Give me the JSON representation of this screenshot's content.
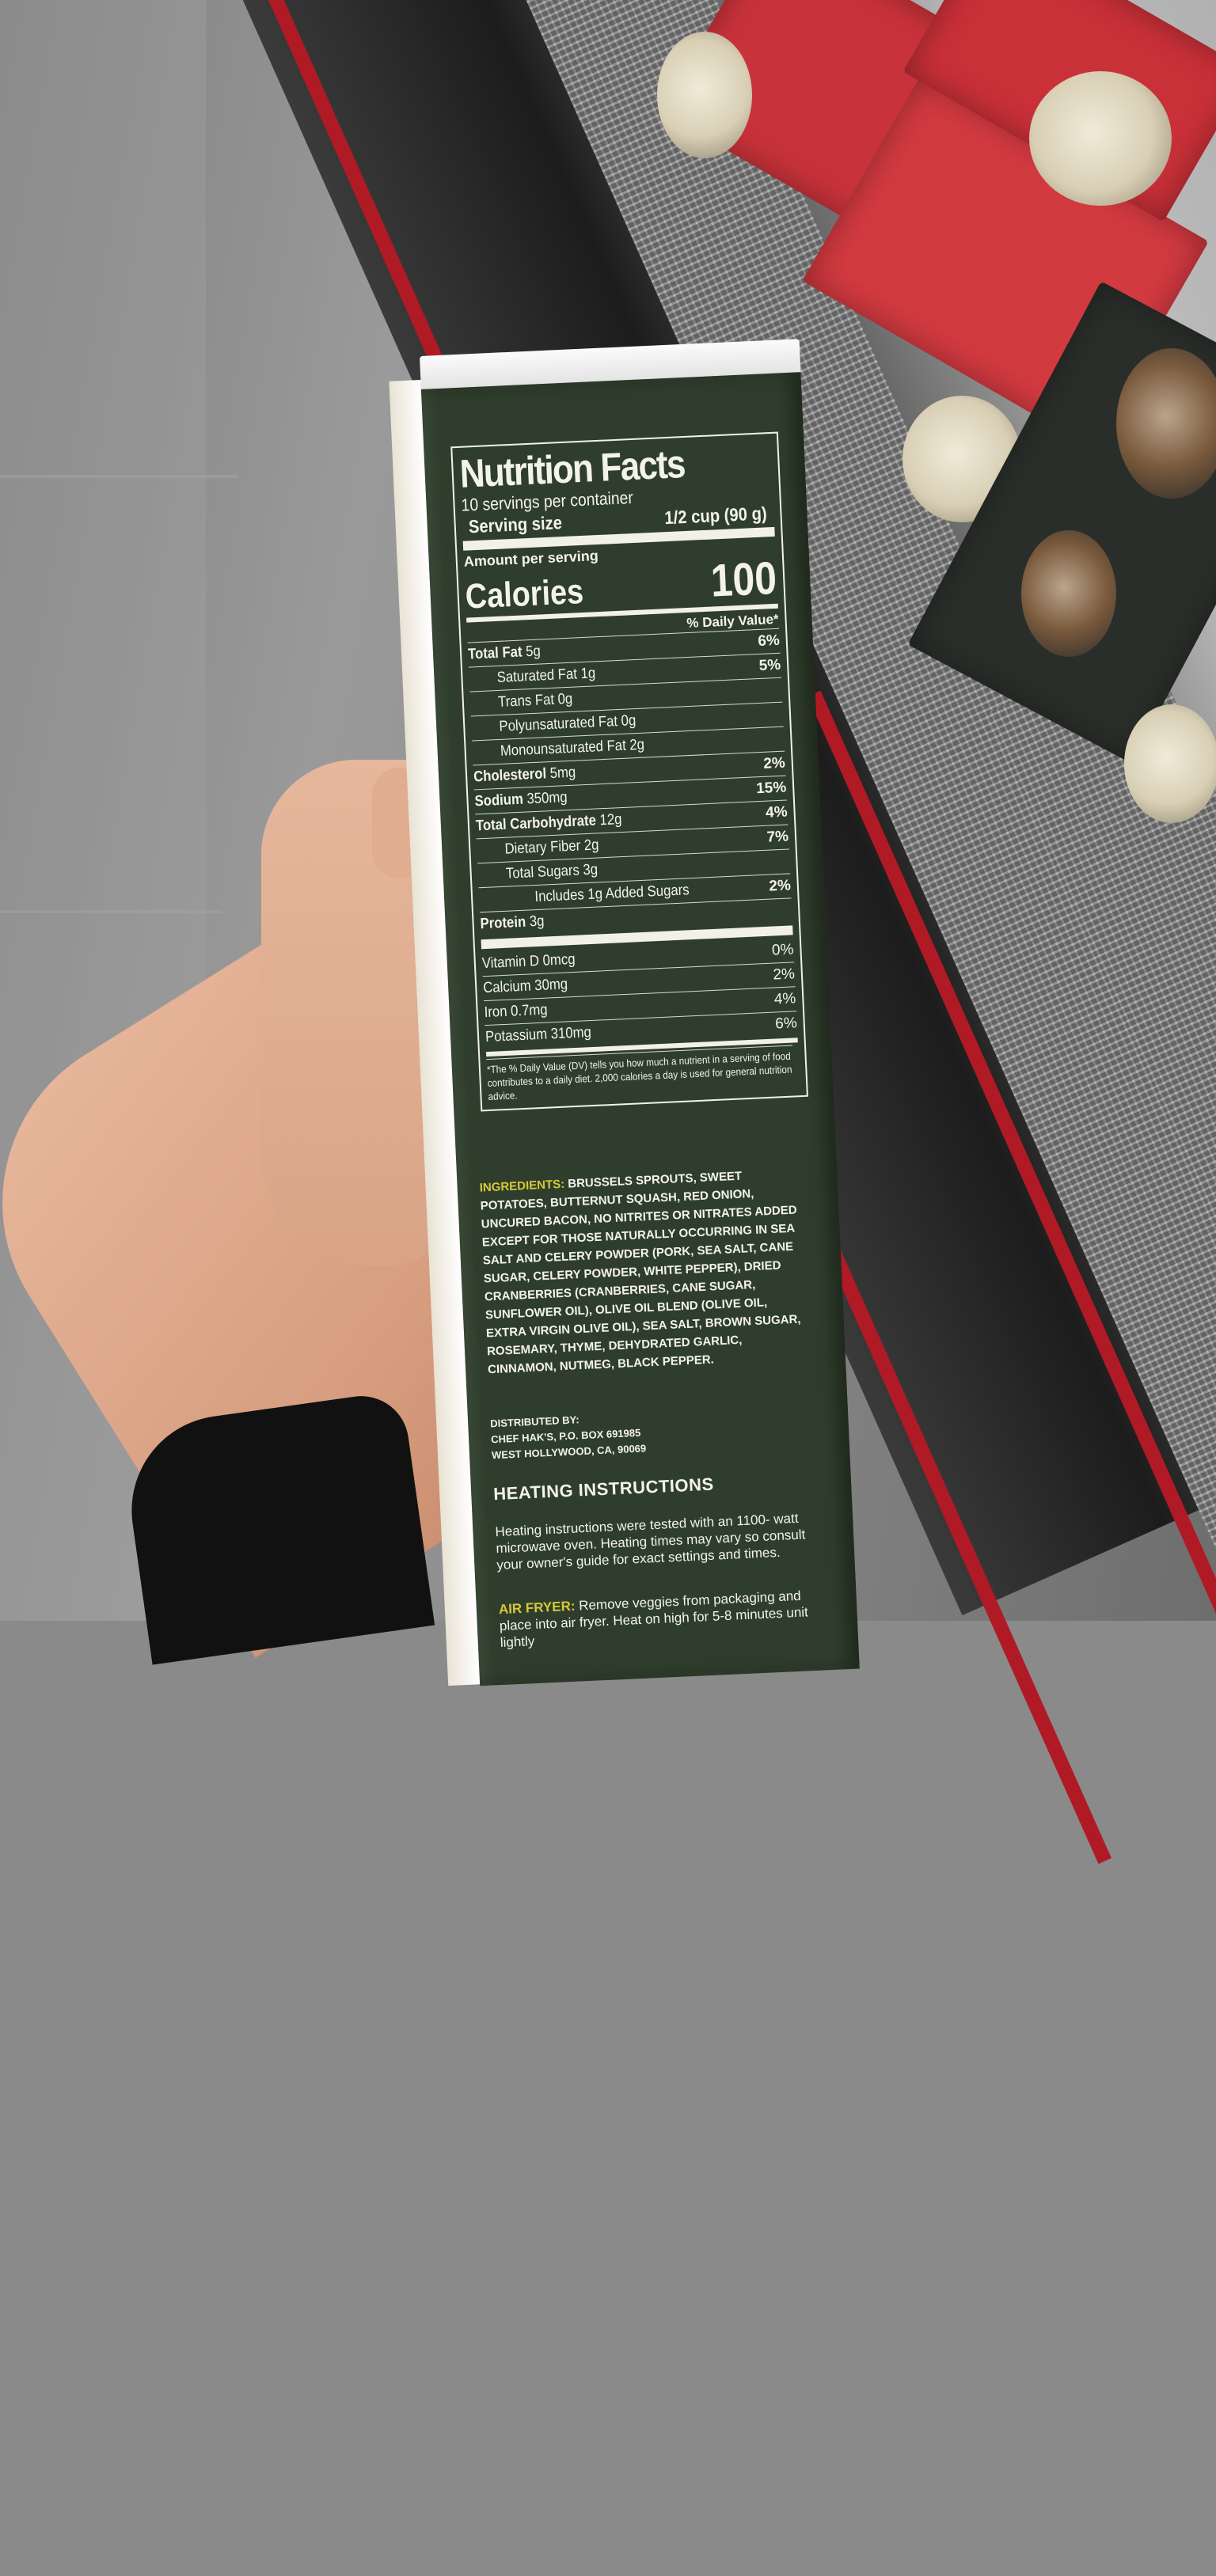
{
  "nutrition": {
    "title": "Nutrition Facts",
    "servings": "10 servings per container",
    "serving_size_label": "Serving size",
    "serving_size_value": "1/2 cup (90 g)",
    "amount_per_serving": "Amount per serving",
    "calories_label": "Calories",
    "calories_value": "100",
    "dv_header": "% Daily Value*",
    "rows": [
      {
        "bold": "Total Fat",
        "rest": " 5g",
        "pct": "6%"
      },
      {
        "bold": "",
        "rest": "Saturated Fat 1g",
        "pct": "5%"
      },
      {
        "bold": "",
        "rest": "Trans Fat 0g",
        "pct": ""
      },
      {
        "bold": "",
        "rest": "Polyunsaturated Fat 0g",
        "pct": ""
      },
      {
        "bold": "",
        "rest": "Monounsaturated Fat 2g",
        "pct": ""
      },
      {
        "bold": "Cholesterol",
        "rest": " 5mg",
        "pct": "2%"
      },
      {
        "bold": "Sodium",
        "rest": " 350mg",
        "pct": "15%"
      },
      {
        "bold": "Total Carbohydrate",
        "rest": " 12g",
        "pct": "4%"
      },
      {
        "bold": "",
        "rest": "Dietary Fiber 2g",
        "pct": "7%"
      },
      {
        "bold": "",
        "rest": "Total Sugars 3g",
        "pct": ""
      },
      {
        "bold": "",
        "rest": "Includes 1g Added Sugars",
        "pct": "2%"
      },
      {
        "bold": "Protein",
        "rest": " 3g",
        "pct": ""
      }
    ],
    "vitamins": [
      {
        "label": "Vitamin D 0mcg",
        "pct": "0%"
      },
      {
        "label": "Calcium 30mg",
        "pct": "2%"
      },
      {
        "label": "Iron 0.7mg",
        "pct": "4%"
      },
      {
        "label": "Potassium 310mg",
        "pct": "6%"
      }
    ],
    "footnote": "*The % Daily Value (DV) tells you how much a nutrient in a serving of food contributes to a daily diet. 2,000 calories a day is used for general nutrition advice."
  },
  "ingredients": {
    "label": "INGREDIENTS:",
    "text": " BRUSSELS SPROUTS, SWEET POTATOES, BUTTERNUT SQUASH, RED ONION, UNCURED BACON, NO NITRITES OR NITRATES ADDED EXCEPT FOR THOSE NATURALLY OCCURRING IN SEA SALT AND CELERY POWDER (PORK, SEA SALT, CANE SUGAR, CELERY POWDER, WHITE PEPPER), DRIED CRANBERRIES (CRANBERRIES, CANE SUGAR, SUNFLOWER OIL), OLIVE OIL BLEND (OLIVE OIL, EXTRA VIRGIN OLIVE OIL), SEA SALT, BROWN SUGAR, ROSEMARY, THYME, DEHYDRATED GARLIC, CINNAMON, NUTMEG, BLACK PEPPER."
  },
  "distributed": {
    "line1": "DISTRIBUTED BY:",
    "line2": "CHEF HAK'S, P.O. BOX 691985",
    "line3": "WEST HOLLYWOOD, CA, 90069"
  },
  "heating": {
    "title": "HEATING INSTRUCTIONS",
    "body": "Heating instructions were tested with an 1100- watt microwave oven. Heating times may vary so consult your owner's guide for exact settings and times.",
    "air_label": "AIR FRYER:",
    "air_text": " Remove veggies from packaging and place into air fryer. Heat on high for 5-8 minutes unit lightly"
  }
}
